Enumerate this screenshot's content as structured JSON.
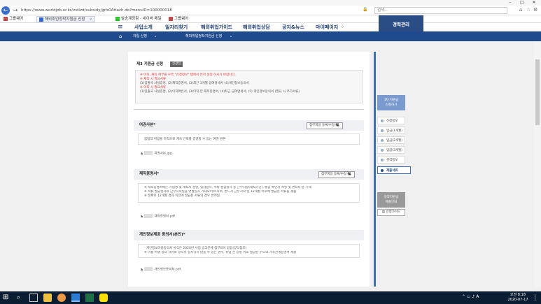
{
  "browser": {
    "url": "https://www.worldjob.or.kr/indivd/subsidy/jpfs0Attach.do?menuID=100000018",
    "search_placeholder": "검색...",
    "tabs": [
      {
        "label": "그룹웨어"
      },
      {
        "label": "해외취업정착지원금 신청"
      },
      {
        "label": "발송계정함 · 네이버 메일"
      },
      {
        "label": "그룹웨어"
      }
    ],
    "window_controls": [
      "–",
      "□",
      "✕"
    ]
  },
  "site": {
    "menu": [
      "사업소개",
      "일자리찾기",
      "해외취업가이드",
      "해외취업상담",
      "공지&뉴스",
      "마이페이지"
    ],
    "mgmt_button": "경력관리",
    "breadcrumb": [
      "자립 신청",
      "해외취업정착지원금 신청"
    ]
  },
  "main": {
    "apply_title": "제3 지원금 신청",
    "apply_badge": "신청전",
    "notice_lines": [
      {
        "text": "※ 이직, 재직 여부를 우측 \"신청정보\" 탭에서 먼저 설정 하시기 바랍니다.",
        "color": "red"
      },
      {
        "text": "※ 재직 시 필요서류",
        "color": "red"
      },
      {
        "text": "(1)입출국 사실증명, (2)재직증명서, (3)최근 3개월 급여명세서 (4)개인정보동의서",
        "color": "gray"
      },
      {
        "text": "※ 이직 시 필요서류",
        "color": "red"
      },
      {
        "text": "(1)입출국 사실증명, (2)이직확인서, (3)이직 전 재직증명서, (4)최근 급여명세서, (5) 개인정보동의서 (필요 시 추가서류)",
        "color": "gray"
      }
    ],
    "sections": [
      {
        "title": "여권사본*",
        "button": "첨부파일 등록/수정",
        "desc": [
          "합법적 취업을 목적으로 계속 근로를 증명할 수 있는 여권 원본"
        ],
        "file": "여권사본.jpg"
      },
      {
        "title": "재직증명서*",
        "button": "첨부파일 등록/수정",
        "desc": [
          "※ 재직증명서에는 기업명 및 재직자 성명, 입사일자, 서류 발급일자 등 근무사항(재직기간), 발급 확인자 서명 및 연락처 등 기재",
          "※ 서류 발급일자와 근무시작일을 연월일자 기재되어야 하며, 반드시 근무시작 일 12개월 이후에 발급된 서류를 제출",
          "※ 정확히 12개월 경과 이전에 발급된 서류의 경우 반려됨."
        ],
        "file": "재직증명서.pdf"
      },
      {
        "title": "개인정보제공 동의서(본인)*",
        "button": "",
        "desc": [
          "· 개인정보이용동의서 서식은 2020년 사업 공고문에 첨부되어 있음(양식참조)",
          "※ 이름·서명 등의 사유로 양식이 일치하지 않을 수 있는 경우, 취업 전 증빙 이후 발급된 부모의 가족관계증명서 제출"
        ],
        "file": "개인정보동의서.pdf"
      }
    ]
  },
  "sidenav": {
    "top_button": [
      "3차 지원금",
      "신청하기"
    ],
    "steps": [
      {
        "label": "신청정보",
        "active": false
      },
      {
        "label": "입금(1개월)",
        "active": false
      },
      {
        "label": "입금(2개월)",
        "active": false
      },
      {
        "label": "입금(3개월)",
        "active": false
      },
      {
        "label": "경력정보",
        "active": false
      },
      {
        "label": "제출서류",
        "active": true
      }
    ],
    "bottom_button": [
      "정착지원금",
      "제출안내"
    ],
    "guide_button": "신청가이드"
  },
  "taskbar": {
    "time": "오전 8:18",
    "date": "2020-07-17"
  },
  "colors": {
    "brand_blue": "#1f4a8e",
    "side_line": "#3d6fb5",
    "notice_red": "#d33333"
  }
}
